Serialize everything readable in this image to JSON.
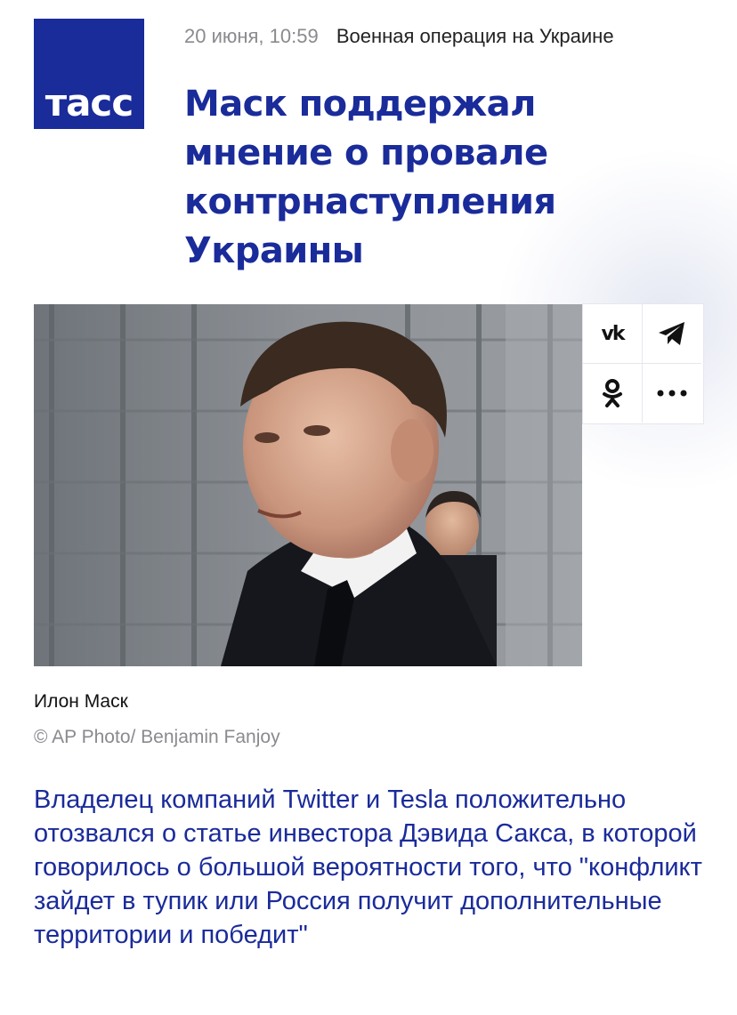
{
  "logo": {
    "text": "тасс"
  },
  "meta": {
    "date": "20 июня, 10:59",
    "rubric": "Военная операция на Украине"
  },
  "article": {
    "headline": "Маск поддержал мнение о провале контрнаступления Украины",
    "photo_caption": "Илон Маск",
    "photo_credit": "© AP Photo/ Benjamin Fanjoy",
    "lead": "Владелец компаний Twitter и Tesla положительно отозвался о статье инвестора Дэвида Сакса, в которой говорилось о большой вероятности того, что \"конфликт зайдет в тупик или Россия получит дополнительные территории и победит\""
  },
  "share": {
    "vk_label": "vk",
    "icons": [
      "vk-icon",
      "telegram-icon",
      "odnoklassniki-icon",
      "more-icon"
    ]
  },
  "colors": {
    "brand": "#1a2b9a",
    "muted": "#8a8a8f",
    "text": "#222222"
  }
}
